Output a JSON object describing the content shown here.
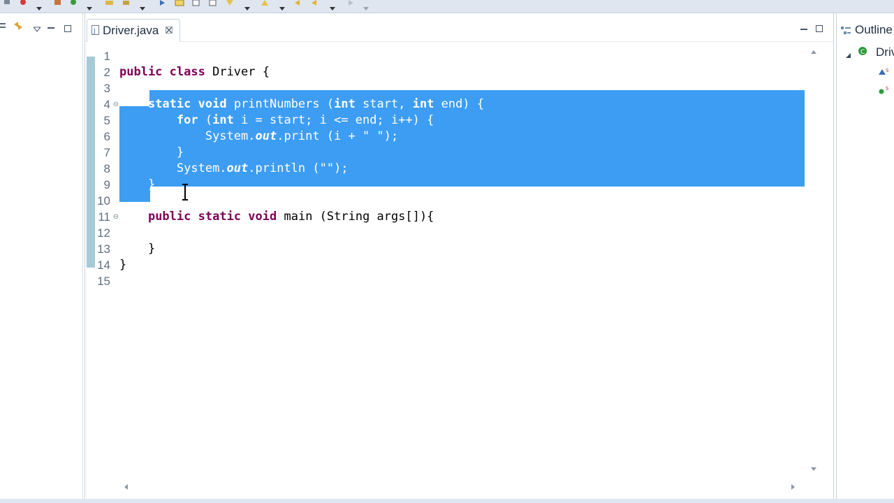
{
  "editor": {
    "tab_label": "Driver.java",
    "tab_close_icon": "close-icon",
    "line_numbers": [
      "1",
      "2",
      "3",
      "4",
      "5",
      "6",
      "7",
      "8",
      "9",
      "10",
      "11",
      "12",
      "13",
      "14",
      "15"
    ],
    "code": {
      "l2_kw1": "public",
      "l2_kw2": "class",
      "l2_text": " Driver {",
      "l4_kw1": "static",
      "l4_kw2": "void",
      "l4_t1": " printNumbers (",
      "l4_kw3": "int",
      "l4_t2": " start, ",
      "l4_kw4": "int",
      "l4_t3": " end) {",
      "l5_kw1": "for",
      "l5_t1": " (",
      "l5_kw2": "int",
      "l5_t2": " i = start; i <= end; i++) {",
      "l6_t1": "System.",
      "l6_it": "out",
      "l6_t2": ".print (i + \" \");",
      "l7_t1": "}",
      "l8_t1": "System.",
      "l8_it": "out",
      "l8_t2": ".println (\"\");",
      "l9_t1": "}",
      "l11_kw1": "public",
      "l11_kw2": "static",
      "l11_kw3": "void",
      "l11_t1": " main (String args[]){",
      "l13_t1": "}",
      "l14_t1": "}"
    }
  },
  "outline": {
    "title": "Outline",
    "item_class": "Driv"
  },
  "colors": {
    "selection": "#3d9df3",
    "keyword": "#7f0055",
    "field": "#0000c0",
    "gutter_marker": "#a5cbd6"
  }
}
